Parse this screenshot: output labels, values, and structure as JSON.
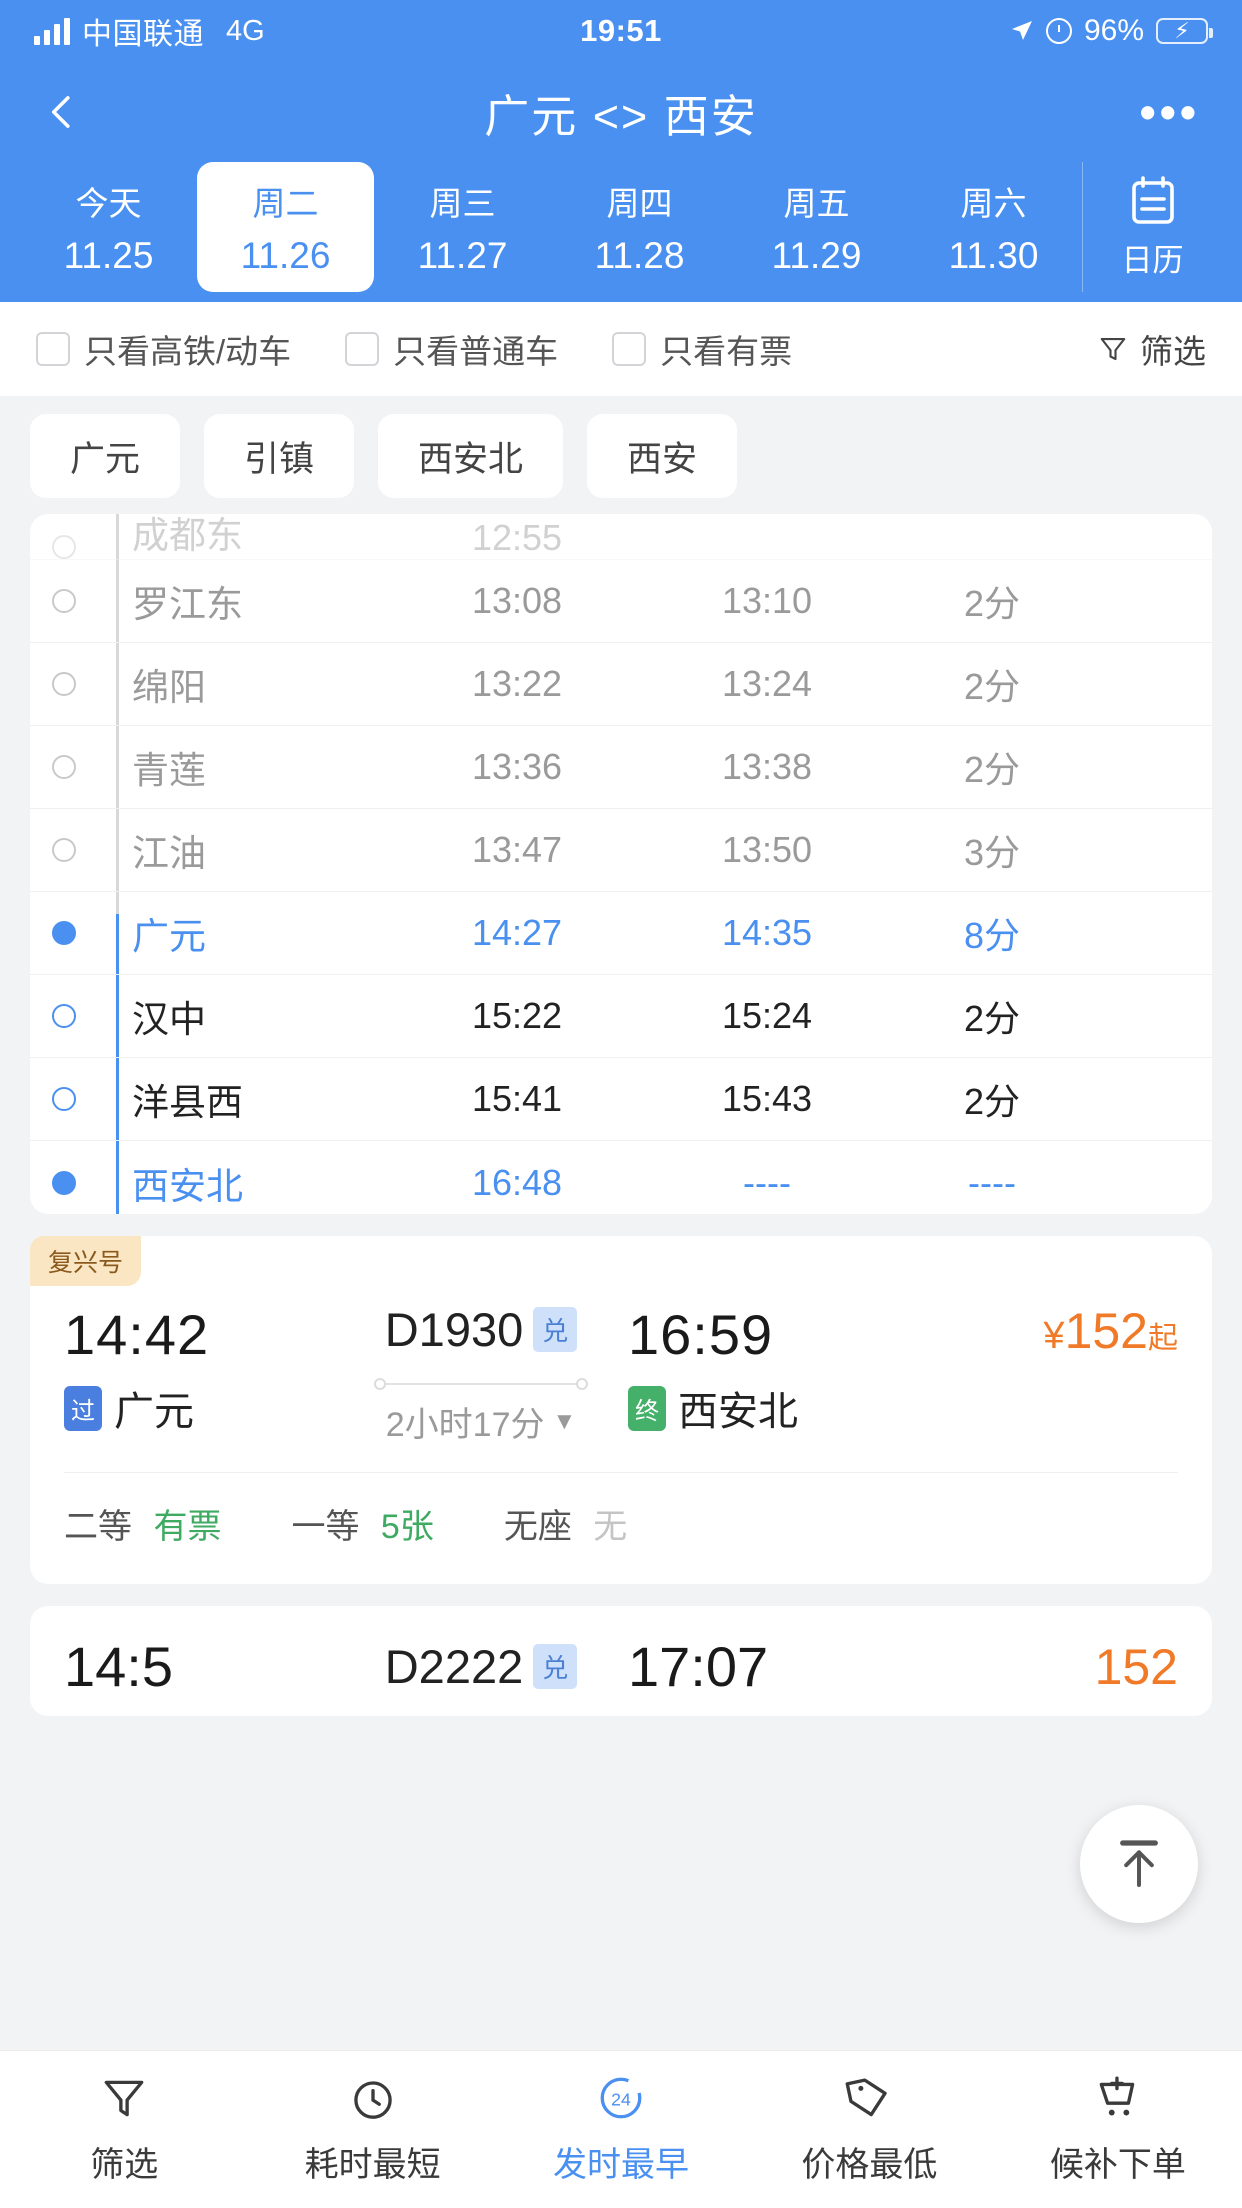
{
  "status_bar": {
    "carrier": "中国联通",
    "network": "4G",
    "time": "19:51",
    "battery_percent": "96%"
  },
  "header": {
    "title": "广元 <> 西安",
    "back_icon": "chevron-left-icon",
    "more_icon": "more-horizontal-icon",
    "dates": [
      {
        "weekday": "今天",
        "date": "11.25",
        "active": false
      },
      {
        "weekday": "周二",
        "date": "11.26",
        "active": true
      },
      {
        "weekday": "周三",
        "date": "11.27",
        "active": false
      },
      {
        "weekday": "周四",
        "date": "11.28",
        "active": false
      },
      {
        "weekday": "周五",
        "date": "11.29",
        "active": false
      },
      {
        "weekday": "周六",
        "date": "11.30",
        "active": false
      }
    ],
    "calendar_button": {
      "label": "日历",
      "icon": "calendar-icon"
    }
  },
  "filters": {
    "checkboxes": [
      {
        "label": "只看高铁/动车",
        "checked": false
      },
      {
        "label": "只看普通车",
        "checked": false
      },
      {
        "label": "只看有票",
        "checked": false
      }
    ],
    "filter_button": {
      "label": "筛选",
      "icon": "funnel-icon"
    }
  },
  "station_chips": [
    "广元",
    "引镇",
    "西安北",
    "西安"
  ],
  "stop_list": {
    "rows": [
      {
        "station": "成都东",
        "arrive": "12:55",
        "depart": "",
        "stay": "",
        "style": "clipped"
      },
      {
        "station": "罗江东",
        "arrive": "13:08",
        "depart": "13:10",
        "stay": "2分",
        "style": "gray"
      },
      {
        "station": "绵阳",
        "arrive": "13:22",
        "depart": "13:24",
        "stay": "2分",
        "style": "gray"
      },
      {
        "station": "青莲",
        "arrive": "13:36",
        "depart": "13:38",
        "stay": "2分",
        "style": "gray"
      },
      {
        "station": "江油",
        "arrive": "13:47",
        "depart": "13:50",
        "stay": "3分",
        "style": "gray"
      },
      {
        "station": "广元",
        "arrive": "14:27",
        "depart": "14:35",
        "stay": "8分",
        "style": "highlight"
      },
      {
        "station": "汉中",
        "arrive": "15:22",
        "depart": "15:24",
        "stay": "2分",
        "style": "dark"
      },
      {
        "station": "洋县西",
        "arrive": "15:41",
        "depart": "15:43",
        "stay": "2分",
        "style": "dark"
      },
      {
        "station": "西安北",
        "arrive": "16:48",
        "depart": "----",
        "stay": "----",
        "style": "highlight"
      }
    ]
  },
  "train_card": {
    "tag": "复兴号",
    "depart_time": "14:42",
    "train_no": "D1930",
    "train_badge": "兑",
    "arrive_time": "16:59",
    "price": {
      "currency": "¥",
      "amount": "152",
      "suffix": "起"
    },
    "from_marker": "过",
    "from_station": "广元",
    "duration": "2小时17分",
    "duration_caret": "▼",
    "to_marker": "终",
    "to_station": "西安北",
    "seats": [
      {
        "label": "二等",
        "value": "有票",
        "state": "ok"
      },
      {
        "label": "一等",
        "value": "5张",
        "state": "ok"
      },
      {
        "label": "无座",
        "value": "无",
        "state": "none"
      }
    ]
  },
  "train_card_partial": {
    "depart_time": "14:5",
    "train_no": "D2222",
    "train_badge": "兑",
    "arrive_time": "17:07",
    "price": "152"
  },
  "scroll_top_button": {
    "icon": "arrow-up-to-line-icon"
  },
  "bottom_bar": {
    "items": [
      {
        "label": "筛选",
        "icon": "funnel-icon",
        "active": false
      },
      {
        "label": "耗时最短",
        "icon": "clock-icon",
        "active": false
      },
      {
        "label": "发时最早",
        "icon": "clock-24-icon",
        "active": true
      },
      {
        "label": "价格最低",
        "icon": "price-tag-icon",
        "active": false
      },
      {
        "label": "候补下单",
        "icon": "cart-plus-icon",
        "active": false
      }
    ]
  },
  "colors": {
    "brand_blue": "#4a90f0",
    "price_orange": "#f07a28",
    "seat_green": "#3faa62",
    "tag_bg": "#fbe6c4"
  }
}
